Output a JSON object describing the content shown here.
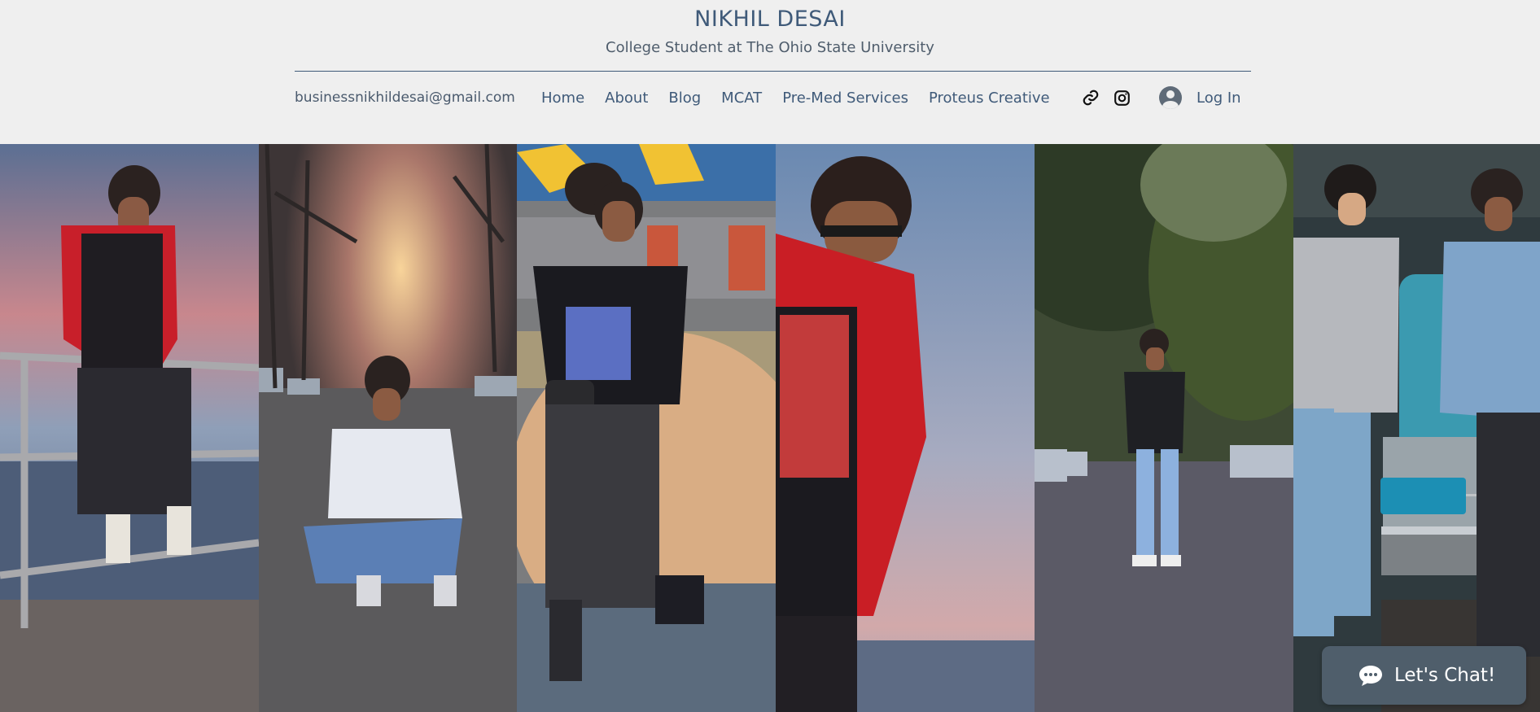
{
  "header": {
    "site_title": "NIKHIL DESAI",
    "tagline": "College Student at The Ohio State University",
    "email": "businessnikhildesai@gmail.com"
  },
  "nav": {
    "items": [
      {
        "label": "Home"
      },
      {
        "label": "About"
      },
      {
        "label": "Blog"
      },
      {
        "label": "MCAT"
      },
      {
        "label": "Pre-Med Services"
      },
      {
        "label": "Proteus Creative"
      }
    ]
  },
  "social": {
    "icons": [
      "link-icon",
      "instagram-icon"
    ]
  },
  "auth": {
    "login_label": "Log In"
  },
  "gallery": {
    "photos": [
      {
        "subject": "man in red Chicago jacket leaning on railing by lake"
      },
      {
        "subject": "man crouching on street at sunset"
      },
      {
        "subject": "man with glasses sitting on concrete dome"
      },
      {
        "subject": "close-up of man in red Chicago jacket and sunglasses"
      },
      {
        "subject": "man standing on tree-lined street"
      },
      {
        "subject": "two men standing by vintage teal car"
      }
    ]
  },
  "chat": {
    "label": "Let's Chat!"
  },
  "colors": {
    "header_bg": "#efefef",
    "brand_blue": "#3f5a79",
    "chat_bg": "#4f5e6b"
  }
}
